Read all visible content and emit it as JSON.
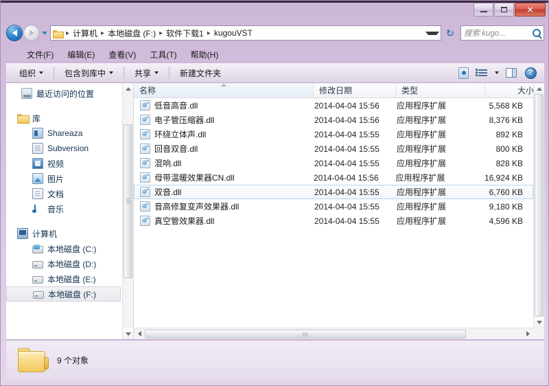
{
  "window": {
    "titlebar": {
      "minimize_label": "",
      "maximize_label": "",
      "close_label": "✕"
    }
  },
  "address": {
    "breadcrumbs": [
      "计算机",
      "本地磁盘 (F:)",
      "软件下载1",
      "kugouVST"
    ],
    "separator": "▸",
    "refresh_label": "↻",
    "search_placeholder": "搜索 kugo..."
  },
  "menu": {
    "items": [
      "文件(F)",
      "编辑(E)",
      "查看(V)",
      "工具(T)",
      "帮助(H)"
    ]
  },
  "toolbar": {
    "organize_label": "组织",
    "include_library_label": "包含到库中",
    "share_label": "共享",
    "new_folder_label": "新建文件夹",
    "help_glyph": "?"
  },
  "sidebar": {
    "items": [
      {
        "label": "最近访问的位置",
        "icon": "recent-icon",
        "level": "top",
        "selected": false
      },
      {
        "label": "库",
        "icon": "library-icon",
        "level": "group",
        "selected": false
      },
      {
        "label": "Shareaza",
        "icon": "shareaza-icon",
        "level": "child",
        "selected": false
      },
      {
        "label": "Subversion",
        "icon": "subversion-icon",
        "level": "child",
        "selected": false
      },
      {
        "label": "视频",
        "icon": "video-icon",
        "level": "child",
        "selected": false
      },
      {
        "label": "图片",
        "icon": "picture-icon",
        "level": "child",
        "selected": false
      },
      {
        "label": "文档",
        "icon": "document-icon",
        "level": "child",
        "selected": false
      },
      {
        "label": "音乐",
        "icon": "music-icon",
        "level": "child",
        "selected": false
      },
      {
        "label": "计算机",
        "icon": "computer-icon",
        "level": "group",
        "selected": false
      },
      {
        "label": "本地磁盘 (C:)",
        "icon": "system-drive-icon",
        "level": "child",
        "selected": false
      },
      {
        "label": "本地磁盘 (D:)",
        "icon": "drive-icon",
        "level": "child",
        "selected": false
      },
      {
        "label": "本地磁盘 (E:)",
        "icon": "drive-icon",
        "level": "child",
        "selected": false
      },
      {
        "label": "本地磁盘 (F:)",
        "icon": "drive-icon",
        "level": "child",
        "selected": true
      }
    ]
  },
  "filelist": {
    "columns": [
      "名称",
      "修改日期",
      "类型",
      "大小"
    ],
    "sort_column": "名称",
    "sort_direction": "ascending",
    "rows": [
      {
        "name": "低音高音.dll",
        "date": "2014-04-04 15:56",
        "type": "应用程序扩展",
        "size": "5,568 KB",
        "selected": false
      },
      {
        "name": "电子管压缩器.dll",
        "date": "2014-04-04 15:56",
        "type": "应用程序扩展",
        "size": "8,376 KB",
        "selected": false
      },
      {
        "name": "环绕立体声.dll",
        "date": "2014-04-04 15:55",
        "type": "应用程序扩展",
        "size": "892 KB",
        "selected": false
      },
      {
        "name": "回音双音.dll",
        "date": "2014-04-04 15:55",
        "type": "应用程序扩展",
        "size": "800 KB",
        "selected": false
      },
      {
        "name": "混响.dll",
        "date": "2014-04-04 15:55",
        "type": "应用程序扩展",
        "size": "828 KB",
        "selected": false
      },
      {
        "name": "母带温暖效果器CN.dll",
        "date": "2014-04-04 15:56",
        "type": "应用程序扩展",
        "size": "16,924 KB",
        "selected": false
      },
      {
        "name": "双音.dll",
        "date": "2014-04-04 15:55",
        "type": "应用程序扩展",
        "size": "6,760 KB",
        "selected": true
      },
      {
        "name": "音高修复变声效果器.dll",
        "date": "2014-04-04 15:55",
        "type": "应用程序扩展",
        "size": "9,180 KB",
        "selected": false
      },
      {
        "name": "真空管效果器.dll",
        "date": "2014-04-04 15:55",
        "type": "应用程序扩展",
        "size": "4,596 KB",
        "selected": false
      }
    ]
  },
  "statusbar": {
    "item_count_label": "9 个对象"
  },
  "colors": {
    "window_chrome": "#d2bfd9",
    "close_button": "#c4432f",
    "selection_border": "#b4d4ef",
    "link_text": "#13314f"
  }
}
